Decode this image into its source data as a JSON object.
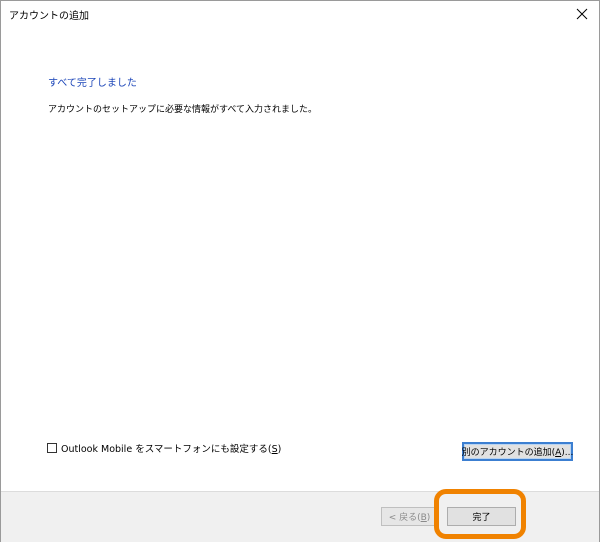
{
  "window": {
    "title": "アカウントの追加"
  },
  "content": {
    "heading": "すべて完了しました",
    "description": "アカウントのセットアップに必要な情報がすべて入力されました。"
  },
  "mobile_option": {
    "label_prefix": "Outlook Mobile をスマートフォンにも設定する(",
    "accelerator": "S",
    "label_suffix": ")",
    "checked": false
  },
  "add_account": {
    "label_prefix": "別のアカウントの追加(",
    "accelerator": "A",
    "label_suffix": ")..."
  },
  "footer": {
    "back_prefix": "< 戻る(",
    "back_accelerator": "B",
    "back_suffix": ")",
    "finish_label": "完了"
  },
  "colors": {
    "heading": "#1a44b8",
    "highlight": "#f08200",
    "focus_border": "#3c7fd1"
  },
  "icons": {
    "close": "close-icon"
  }
}
